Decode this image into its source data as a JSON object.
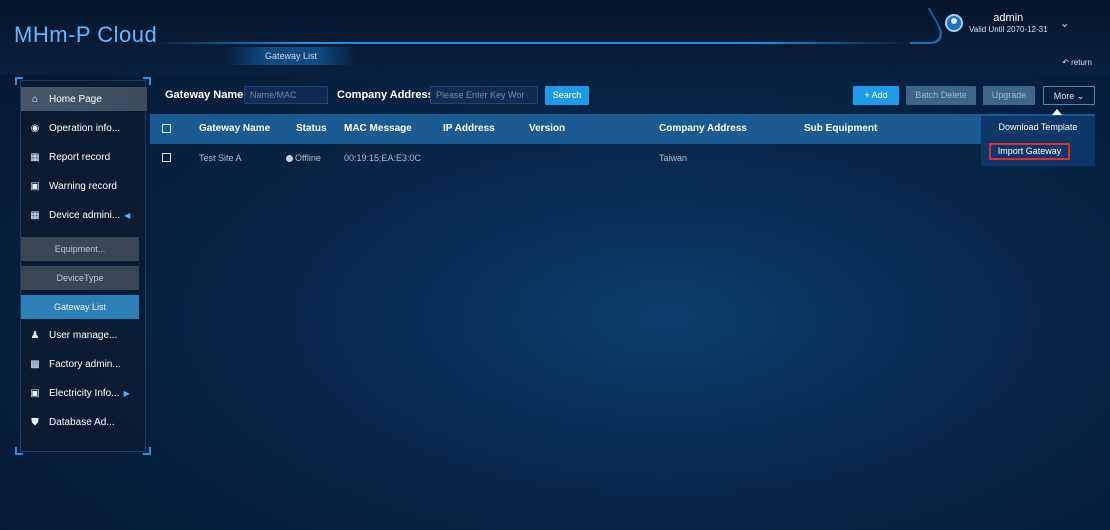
{
  "header": {
    "app_title": "MHm-P Cloud",
    "page_tab": "Gateway List",
    "user": {
      "name": "admin",
      "valid_until": "Valid Until 2070-12-31"
    },
    "return_label": "return"
  },
  "sidebar": {
    "items": [
      {
        "label": "Home Page",
        "icon": "home-icon"
      },
      {
        "label": "Operation info...",
        "icon": "gear-icon"
      },
      {
        "label": "Report record",
        "icon": "report-icon"
      },
      {
        "label": "Warning record",
        "icon": "warning-icon"
      },
      {
        "label": "Device admini...",
        "icon": "device-icon"
      },
      {
        "label": "User manage...",
        "icon": "user-icon"
      },
      {
        "label": "Factory admin...",
        "icon": "factory-icon"
      },
      {
        "label": "Electricity Info...",
        "icon": "electricity-icon"
      },
      {
        "label": "Database Ad...",
        "icon": "database-icon"
      }
    ],
    "sub_items": [
      {
        "label": "Equipment..."
      },
      {
        "label": "DeviceType"
      },
      {
        "label": "Gateway List"
      }
    ]
  },
  "toolbar": {
    "gateway_name_label": "Gateway Name",
    "gateway_name_placeholder": "Name/MAC",
    "company_address_label": "Company Address",
    "company_address_placeholder": "Please Enter Key Wor",
    "search_label": "Search",
    "add_label": "+ Add",
    "batch_delete_label": "Batch Delete",
    "upgrade_label": "Upgrade",
    "more_label": "More"
  },
  "table": {
    "columns": [
      "Gateway Name",
      "Status",
      "MAC Message",
      "IP Address",
      "Version",
      "Company Address",
      "Sub Equipment"
    ],
    "rows": [
      {
        "gateway_name": "Test Site A",
        "status": "Offline",
        "mac": "00:19:15:EA:E3:0C",
        "ip": "",
        "version": "",
        "company_address": "Taiwan",
        "sub_equipment": ""
      }
    ]
  },
  "more_menu": {
    "items": [
      "Download Template",
      "Import Gateway"
    ]
  },
  "colors": {
    "accent": "#1e9be8",
    "header_row": "#195b92",
    "highlight_border": "#e02d2d"
  }
}
